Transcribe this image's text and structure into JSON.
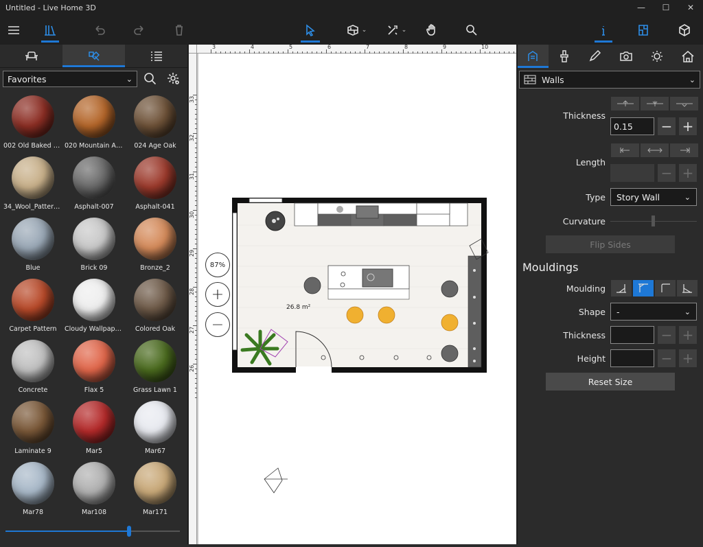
{
  "window": {
    "title": "Untitled - Live Home 3D"
  },
  "library": {
    "selected": "Favorites",
    "materials": [
      {
        "label": "002 Old Baked B...",
        "color": "#8c2e24"
      },
      {
        "label": "020 Mountain Al...",
        "color": "#b4662a"
      },
      {
        "label": "024 Age Oak",
        "color": "#6e5238"
      },
      {
        "label": "34_Wool_Pattern...",
        "color": "#c8b08a"
      },
      {
        "label": "Asphalt-007",
        "color": "#6a6a6a"
      },
      {
        "label": "Asphalt-041",
        "color": "#9c3a2c"
      },
      {
        "label": "Blue",
        "color": "#9aa8b6"
      },
      {
        "label": "Brick 09",
        "color": "#c8c8c8"
      },
      {
        "label": "Bronze_2",
        "color": "#d48a5a"
      },
      {
        "label": "Carpet Pattern",
        "color": "#b84a2a"
      },
      {
        "label": "Cloudy Wallpape...",
        "color": "#eeeeee"
      },
      {
        "label": "Colored Oak",
        "color": "#6e5a48"
      },
      {
        "label": "Concrete",
        "color": "#c0c0c0"
      },
      {
        "label": "Flax 5",
        "color": "#e0664a"
      },
      {
        "label": "Grass Lawn 1",
        "color": "#4a6a1e"
      },
      {
        "label": "Laminate 9",
        "color": "#7a5838"
      },
      {
        "label": "Mar5",
        "color": "#b42a2a"
      },
      {
        "label": "Mar67",
        "color": "#e8eaf0"
      },
      {
        "label": "Mar78",
        "color": "#a8b8c8"
      },
      {
        "label": "Mar108",
        "color": "#b0b0b0"
      },
      {
        "label": "Mar171",
        "color": "#c8a878"
      }
    ],
    "slider_value": 0.71
  },
  "canvas": {
    "zoom": "87%",
    "area_label": "26.8 m²",
    "ruler_top": [
      "3",
      "4",
      "5",
      "6",
      "7",
      "8",
      "9",
      "10"
    ],
    "ruler_left": [
      "33",
      "32",
      "31",
      "30",
      "29",
      "28",
      "27",
      "26"
    ]
  },
  "inspector": {
    "object_type": "Walls",
    "labels": {
      "thickness": "Thickness",
      "length": "Length",
      "type": "Type",
      "curvature": "Curvature",
      "flip_sides": "Flip Sides",
      "mouldings": "Mouldings",
      "moulding": "Moulding",
      "shape": "Shape",
      "m_thickness": "Thickness",
      "height": "Height",
      "reset_size": "Reset Size"
    },
    "thickness_value": "0.15",
    "type_value": "Story Wall",
    "shape_value": "-",
    "accent": "#1e78d6"
  }
}
